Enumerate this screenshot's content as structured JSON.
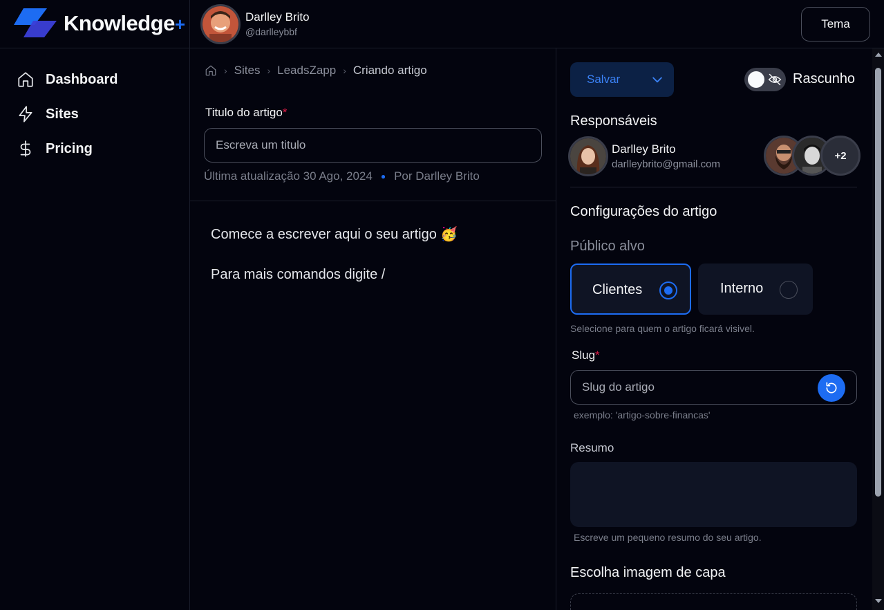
{
  "header": {
    "brand": "Knowledge",
    "brand_plus": "+",
    "user_name": "Darlley Brito",
    "user_handle": "@darlleybbf",
    "tema_label": "Tema"
  },
  "sidebar": {
    "items": [
      {
        "label": "Dashboard",
        "icon": "home-icon"
      },
      {
        "label": "Sites",
        "icon": "lightning-icon"
      },
      {
        "label": "Pricing",
        "icon": "dollar-icon"
      }
    ]
  },
  "main": {
    "breadcrumb": [
      "Sites",
      "LeadsZapp",
      "Criando artigo"
    ],
    "title_label": "Titulo do artigo",
    "required_mark": "*",
    "title_placeholder": "Escreva um titulo",
    "last_update": "Última atualização 30 Ago, 2024",
    "author": "Por Darlley Brito",
    "editor_line_1": "Comece a escrever aqui o seu artigo 🥳",
    "editor_line_2": "Para mais comandos digite /"
  },
  "panel": {
    "save_label": "Salvar",
    "draft_label": "Rascunho",
    "responsibles_title": "Responsáveis",
    "responsible_name": "Darlley Brito",
    "responsible_email": "darlleybrito@gmail.com",
    "more_count": "+2",
    "config_title": "Configurações do artigo",
    "audience_label": "Público alvo",
    "audience_options": [
      {
        "label": "Clientes",
        "selected": true
      },
      {
        "label": "Interno",
        "selected": false
      }
    ],
    "audience_hint": "Selecione para quem o artigo ficará visivel.",
    "slug_label": "Slug",
    "slug_placeholder": "Slug do artigo",
    "slug_hint": "exemplo: 'artigo-sobre-financas'",
    "summary_label": "Resumo",
    "summary_hint": "Escreve um pequeno resumo do seu artigo.",
    "cover_title": "Escolha imagem de capa"
  },
  "colors": {
    "background": "#03040e",
    "accent": "#1d6cf2",
    "required": "#e11d48",
    "card": "#0f1424"
  }
}
